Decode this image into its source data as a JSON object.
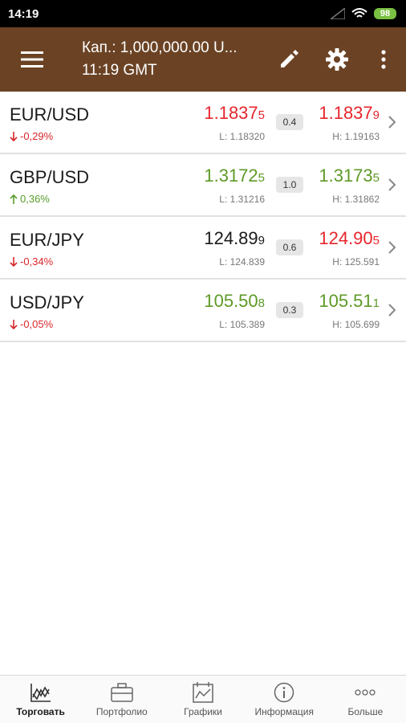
{
  "status": {
    "time": "14:19",
    "battery": "98"
  },
  "header": {
    "capital": "Кап.: 1,000,000.00 U...",
    "time": "11:19 GMT",
    "icons": [
      "menu-icon",
      "pencil-icon",
      "gear-icon",
      "more-vertical-icon"
    ]
  },
  "quotes": [
    {
      "pair": "EUR/USD",
      "change": "-0,29%",
      "direction": "down",
      "bid": "1.1837",
      "bid_pip": "5",
      "bid_color": "red",
      "ask": "1.1837",
      "ask_pip": "9",
      "ask_color": "red",
      "low": "L: 1.18320",
      "high": "H: 1.19163",
      "spread": "0.4"
    },
    {
      "pair": "GBP/USD",
      "change": "0,36%",
      "direction": "up",
      "bid": "1.3172",
      "bid_pip": "5",
      "bid_color": "green",
      "ask": "1.3173",
      "ask_pip": "5",
      "ask_color": "green",
      "low": "L: 1.31216",
      "high": "H: 1.31862",
      "spread": "1.0"
    },
    {
      "pair": "EUR/JPY",
      "change": "-0,34%",
      "direction": "down",
      "bid": "124.89",
      "bid_pip": "9",
      "bid_color": "black",
      "ask": "124.90",
      "ask_pip": "5",
      "ask_color": "red",
      "low": "L: 124.839",
      "high": "H: 125.591",
      "spread": "0.6"
    },
    {
      "pair": "USD/JPY",
      "change": "-0,05%",
      "direction": "down",
      "bid": "105.50",
      "bid_pip": "8",
      "bid_color": "green",
      "ask": "105.51",
      "ask_pip": "1",
      "ask_color": "green",
      "low": "L: 105.389",
      "high": "H: 105.699",
      "spread": "0.3"
    }
  ],
  "nav": [
    {
      "label": "Торговать",
      "icon": "trade-chart-icon",
      "active": true
    },
    {
      "label": "Портфолио",
      "icon": "briefcase-icon",
      "active": false
    },
    {
      "label": "Графики",
      "icon": "calendar-chart-icon",
      "active": false
    },
    {
      "label": "Информация",
      "icon": "info-icon",
      "active": false
    },
    {
      "label": "Больше",
      "icon": "more-horizontal-icon",
      "active": false
    }
  ],
  "colors": {
    "header_bg": "#6b4324",
    "down": "#e6262c",
    "up": "#5e9a26"
  }
}
